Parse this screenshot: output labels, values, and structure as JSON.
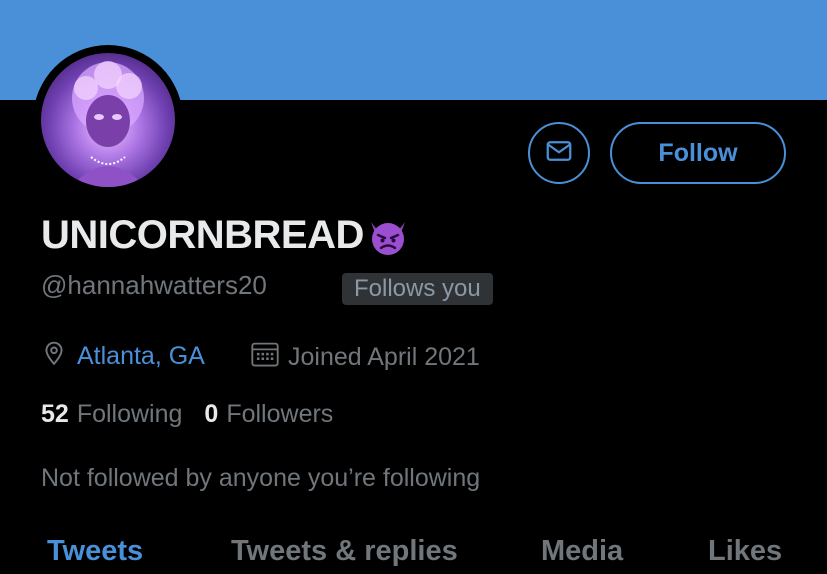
{
  "profile": {
    "display_name": "UNICORNBREAD",
    "name_emoji": "angry-devil-emoji",
    "handle": "@hannahwatters20",
    "follows_you_badge": "Follows you",
    "location": "Atlanta, GA",
    "joined": "Joined April 2021",
    "following_count": "52",
    "following_label": "Following",
    "followers_count": "0",
    "followers_label": "Followers",
    "mutuals_text": "Not followed by anyone you’re following"
  },
  "actions": {
    "follow_label": "Follow",
    "message_icon": "envelope-icon"
  },
  "tabs": [
    {
      "label": "Tweets",
      "active": true
    },
    {
      "label": "Tweets & replies",
      "active": false
    },
    {
      "label": "Media",
      "active": false
    },
    {
      "label": "Likes",
      "active": false
    }
  ],
  "colors": {
    "accent": "#4a90d9",
    "banner": "#4a90d9",
    "background": "#000000",
    "secondary_text": "#71767b"
  }
}
